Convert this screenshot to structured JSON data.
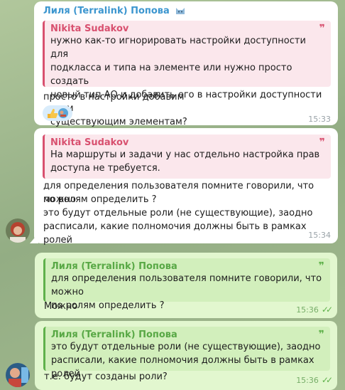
{
  "messages": {
    "m1": {
      "sender": "Лиля (Terralink) Попова",
      "quote_author": "Nikita Sudakov",
      "quote_lines": [
        "нужно как-то игнорировать настройки доступности для",
        "подкласса и типа на элементе или нужно просто создать",
        "новый тип АО и добавить его в настройки доступности всем",
        "существующим элементам?"
      ],
      "text": "просто в настройки добавим",
      "time": "15:33"
    },
    "m2": {
      "quote_author": "Nikita Sudakov",
      "quote_lines": [
        "На маршруты и задачи у нас отдельно настройка прав",
        "доступа не требуется."
      ],
      "text_lines": [
        "для определения пользователя помните говорили, что можно",
        "по ролям определить ?",
        "это будут отдельные роли (не существующие), заодно",
        "расписали, какие полномочия должны быть в рамках ролей"
      ],
      "time": "15:34"
    },
    "m3": {
      "quote_author": "Лиля (Terralink) Попова",
      "quote_lines": [
        "для определения пользователя помните говорили, что можно",
        "по ролям определить ?"
      ],
      "text": "Можно",
      "time": "15:36"
    },
    "m4": {
      "quote_author": "Лиля (Terralink) Попова",
      "quote_lines": [
        "это будут отдельные роли (не существующие), заодно",
        "расписали, какие полномочия должны быть в рамках ролей"
      ],
      "text": "т.е. будут созданы роли?",
      "time": "15:36"
    }
  },
  "quote_mark": "❞",
  "read_checks": "✓✓",
  "colors": {
    "incoming_bubble": "#ffffff",
    "outgoing_bubble": "#e2f7cf",
    "sender_blue": "#3c96cf",
    "quote_pink": "#d8506f",
    "quote_green": "#5fb14b"
  }
}
